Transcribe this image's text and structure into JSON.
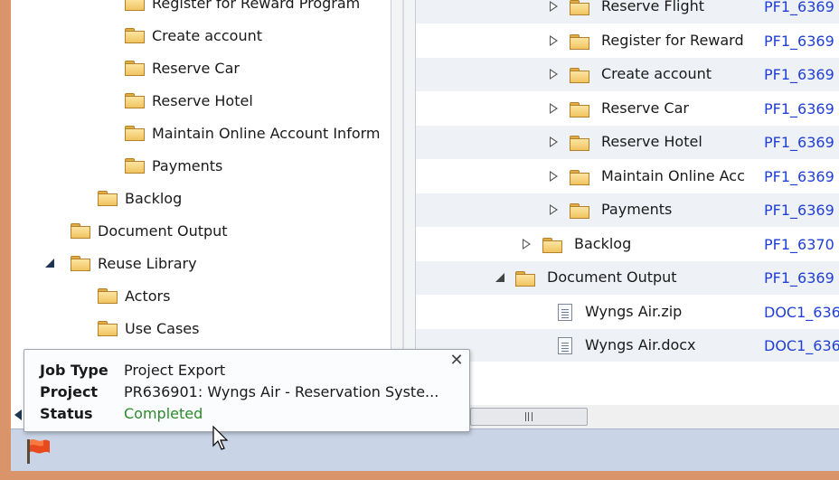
{
  "left_tree": {
    "items": [
      {
        "label": "Register for Reward Program",
        "level": 3
      },
      {
        "label": "Create account",
        "level": 3
      },
      {
        "label": "Reserve Car",
        "level": 3
      },
      {
        "label": "Reserve Hotel",
        "level": 3
      },
      {
        "label": "Maintain Online Account Inform",
        "level": 3
      },
      {
        "label": "Payments",
        "level": 3
      },
      {
        "label": "Backlog",
        "level": 2
      },
      {
        "label": "Document Output",
        "level": 1
      },
      {
        "label": "Reuse Library",
        "level": 1,
        "expanded": true
      },
      {
        "label": "Actors",
        "level": 2
      },
      {
        "label": "Use Cases",
        "level": 2
      }
    ]
  },
  "grid": {
    "rows": [
      {
        "name": "Reserve Flight",
        "id": "PF1_6369",
        "kind": "folder",
        "indent": 2,
        "toggle": "collapsed"
      },
      {
        "name": "Register for Reward",
        "id": "PF1_6369",
        "kind": "folder",
        "indent": 2,
        "toggle": "collapsed"
      },
      {
        "name": "Create account",
        "id": "PF1_6369",
        "kind": "folder",
        "indent": 2,
        "toggle": "collapsed"
      },
      {
        "name": "Reserve Car",
        "id": "PF1_6369",
        "kind": "folder",
        "indent": 2,
        "toggle": "collapsed"
      },
      {
        "name": "Reserve Hotel",
        "id": "PF1_6369",
        "kind": "folder",
        "indent": 2,
        "toggle": "collapsed"
      },
      {
        "name": "Maintain Online Acc",
        "id": "PF1_6369",
        "kind": "folder",
        "indent": 2,
        "toggle": "collapsed"
      },
      {
        "name": "Payments",
        "id": "PF1_6369",
        "kind": "folder",
        "indent": 2,
        "toggle": "collapsed"
      },
      {
        "name": "Backlog",
        "id": "PF1_6370",
        "kind": "folder",
        "indent": 1,
        "toggle": "collapsed"
      },
      {
        "name": "Document Output",
        "id": "PF1_6369",
        "kind": "folder",
        "indent": 0,
        "toggle": "expanded"
      },
      {
        "name": "Wyngs Air.zip",
        "id": "DOC1_636",
        "kind": "document",
        "indent": 1,
        "toggle": "none"
      },
      {
        "name": "Wyngs Air.docx",
        "id": "DOC1_636",
        "kind": "document",
        "indent": 1,
        "toggle": "none"
      }
    ]
  },
  "tooltip": {
    "job_type_label": "Job Type",
    "job_type_value": "Project Export",
    "project_label": "Project",
    "project_value": "PR636901: Wyngs Air - Reservation Syste...",
    "status_label": "Status",
    "status_value": "Completed",
    "close_glyph": "✕"
  },
  "scrollbar": {
    "grip_glyph": "|||"
  },
  "colors": {
    "link": "#1f3fd6",
    "success": "#2b8a2b",
    "frame": "#d9946a",
    "status_bar": "#c9d5e6"
  }
}
